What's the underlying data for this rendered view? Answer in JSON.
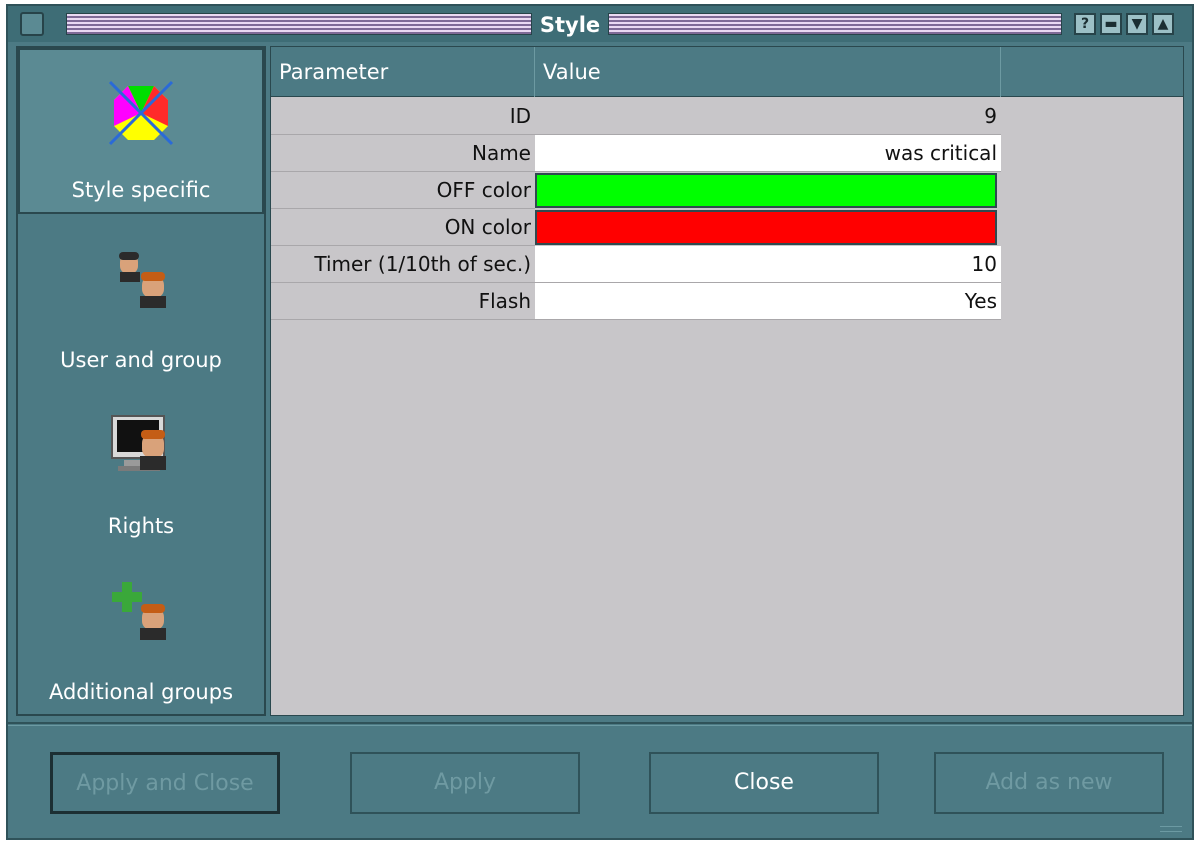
{
  "window": {
    "title": "Style"
  },
  "sidebar": {
    "items": [
      {
        "label": "Style specific",
        "icon": "style-icon",
        "active": true
      },
      {
        "label": "User and group",
        "icon": "users-icon",
        "active": false
      },
      {
        "label": "Rights",
        "icon": "monitor-user-icon",
        "active": false
      },
      {
        "label": "Additional groups",
        "icon": "add-group-icon",
        "active": false
      }
    ]
  },
  "table": {
    "headers": [
      "Parameter",
      "Value"
    ],
    "rows": [
      {
        "param": "ID",
        "value": "9"
      },
      {
        "param": "Name",
        "value": "was critical"
      },
      {
        "param": "OFF color",
        "color": "#00ff00"
      },
      {
        "param": "ON color",
        "color": "#ff0000"
      },
      {
        "param": "Timer (1/10th of sec.)",
        "value": "10"
      },
      {
        "param": "Flash",
        "value": "Yes"
      }
    ]
  },
  "buttons": {
    "apply_close": "Apply and Close",
    "apply": "Apply",
    "close": "Close",
    "add_new": "Add as new"
  }
}
